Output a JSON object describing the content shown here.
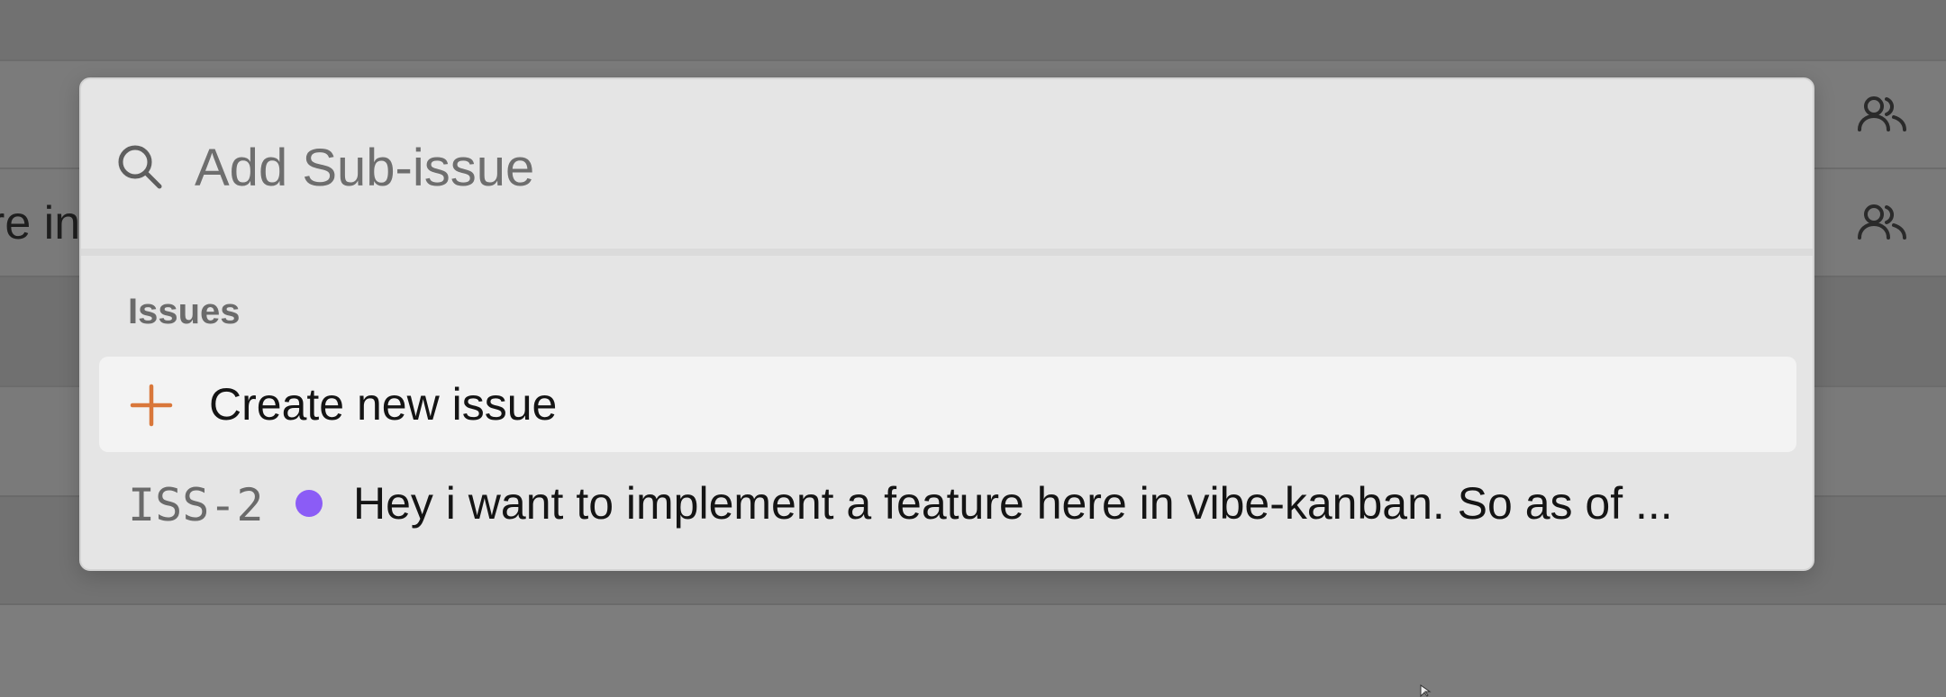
{
  "background": {
    "row_text": "re in"
  },
  "popover": {
    "search": {
      "placeholder": "Add Sub-issue",
      "value": ""
    },
    "group_heading": "Issues",
    "create_item": {
      "label": "Create new issue",
      "icon": "plus-icon",
      "accent_color": "#d9773a"
    },
    "issues": [
      {
        "id": "ISS-2",
        "status_color": "#8b5cf6",
        "title": "Hey i want to implement a feature here in vibe-kanban. So as of ..."
      }
    ]
  }
}
